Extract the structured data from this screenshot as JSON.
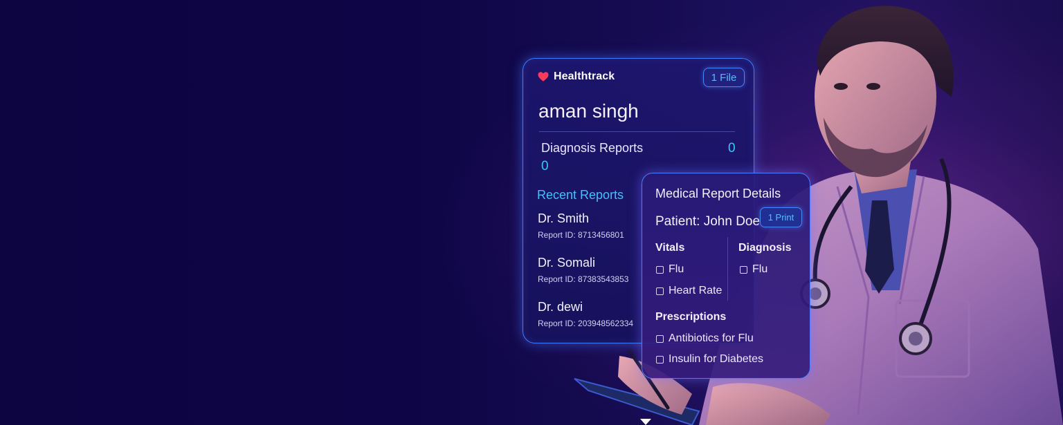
{
  "app": {
    "brand_name": "Healthtrack",
    "brand_icon": "heart-icon",
    "files_badge": "1 File",
    "accent_color": "#3f7cff",
    "highlight_color": "#37c8ff",
    "heart_color": "#ff3b5c"
  },
  "patient_card": {
    "name": "aman singh",
    "diagnosis_label": "Diagnosis Reports",
    "diagnosis_count_right": "0",
    "diagnosis_count_left": "0",
    "recent_title": "Recent Reports",
    "reports": [
      {
        "doctor": "Dr. Smith",
        "report_id": "Report ID: 8713456801"
      },
      {
        "doctor": "Dr. Somali",
        "report_id": "Report ID: 87383543853"
      },
      {
        "doctor": "Dr. dewi",
        "report_id": "Report ID: 203948562334"
      }
    ]
  },
  "details_card": {
    "title": "Medical Report Details",
    "patient": "Patient: John Doe",
    "print_badge": "1 Print",
    "vitals_title": "Vitals",
    "vitals": [
      "Flu",
      "Heart Rate"
    ],
    "diagnosis_title": "Diagnosis",
    "diagnosis": [
      "Flu"
    ],
    "prescriptions_title": "Prescriptions",
    "prescriptions": [
      "Antibiotics for Flu",
      "Insulin for Diabetes"
    ]
  }
}
